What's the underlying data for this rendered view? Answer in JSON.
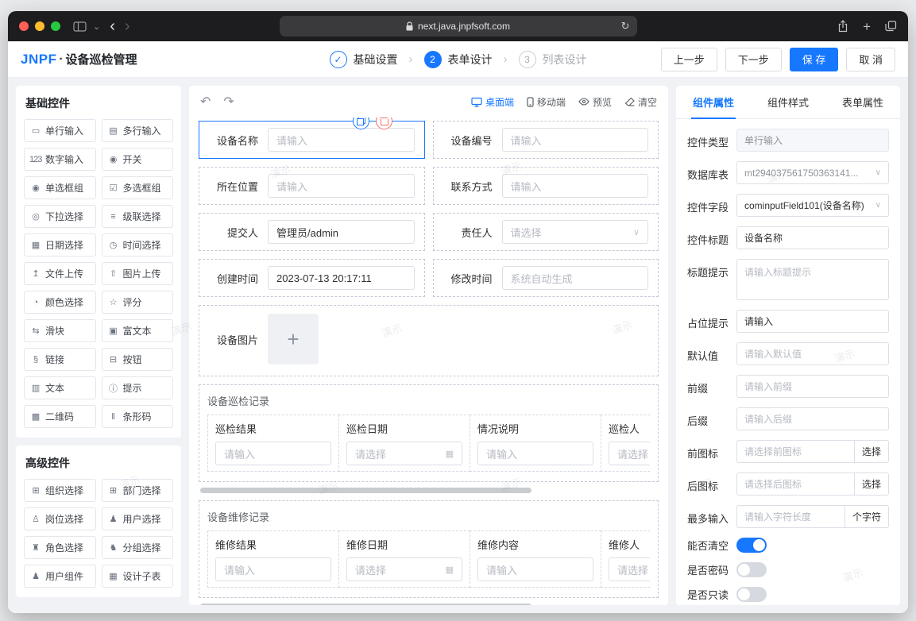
{
  "watermark": "演示",
  "colors": {
    "accent": "#1677ff",
    "danger": "#f56c6c",
    "traffic_red": "#ff5f57",
    "traffic_yellow": "#febc2e",
    "traffic_green": "#28c840"
  },
  "browser": {
    "url": "next.java.jnpfsoft.com"
  },
  "header": {
    "logo": "JNPF",
    "separator": "·",
    "title": "设备巡检管理",
    "steps": [
      {
        "num": "✓",
        "label": "基础设置"
      },
      {
        "num": "2",
        "label": "表单设计"
      },
      {
        "num": "3",
        "label": "列表设计"
      }
    ],
    "actions": [
      "上一步",
      "下一步",
      "保 存",
      "取 消"
    ]
  },
  "sidebar": {
    "groups": [
      {
        "title": "基础控件",
        "name": "basic-controls",
        "items": [
          {
            "icon": "▭",
            "label": "单行输入",
            "name": "single-line-input"
          },
          {
            "icon": "▤",
            "label": "多行输入",
            "name": "multi-line-input"
          },
          {
            "icon": "123",
            "label": "数字输入",
            "name": "number-input"
          },
          {
            "icon": "◉",
            "label": "开关",
            "name": "switch"
          },
          {
            "icon": "◉",
            "label": "单选框组",
            "name": "radio-group"
          },
          {
            "icon": "☑",
            "label": "多选框组",
            "name": "checkbox-group"
          },
          {
            "icon": "◎",
            "label": "下拉选择",
            "name": "select"
          },
          {
            "icon": "≡",
            "label": "级联选择",
            "name": "cascader"
          },
          {
            "icon": "▦",
            "label": "日期选择",
            "name": "date-picker"
          },
          {
            "icon": "◷",
            "label": "时间选择",
            "name": "time-picker"
          },
          {
            "icon": "↥",
            "label": "文件上传",
            "name": "file-upload"
          },
          {
            "icon": "⇧",
            "label": "图片上传",
            "name": "image-upload"
          },
          {
            "icon": "◔",
            "label": "颜色选择",
            "name": "color-picker"
          },
          {
            "icon": "☆",
            "label": "评分",
            "name": "rate"
          },
          {
            "icon": "⇆",
            "label": "滑块",
            "name": "slider"
          },
          {
            "icon": "▣",
            "label": "富文本",
            "name": "rich-text"
          },
          {
            "icon": "§",
            "label": "链接",
            "name": "link"
          },
          {
            "icon": "⊟",
            "label": "按钮",
            "name": "button"
          },
          {
            "icon": "▥",
            "label": "文本",
            "name": "text"
          },
          {
            "icon": "ⓘ",
            "label": "提示",
            "name": "alert"
          },
          {
            "icon": "▩",
            "label": "二维码",
            "name": "qr-code"
          },
          {
            "icon": "‖",
            "label": "条形码",
            "name": "barcode"
          }
        ]
      },
      {
        "title": "高级控件",
        "name": "advanced-controls",
        "items": [
          {
            "icon": "⊞",
            "label": "组织选择",
            "name": "org-select"
          },
          {
            "icon": "⊞",
            "label": "部门选择",
            "name": "dept-select"
          },
          {
            "icon": "♙",
            "label": "岗位选择",
            "name": "post-select"
          },
          {
            "icon": "♟",
            "label": "用户选择",
            "name": "user-select"
          },
          {
            "icon": "♜",
            "label": "角色选择",
            "name": "role-select"
          },
          {
            "icon": "♞",
            "label": "分组选择",
            "name": "group-select"
          },
          {
            "icon": "♟",
            "label": "用户组件",
            "name": "user-component"
          },
          {
            "icon": "▦",
            "label": "设计子表",
            "name": "design-subtable"
          }
        ]
      }
    ]
  },
  "canvas": {
    "toolbar": {
      "modes": [
        {
          "label": "桌面端",
          "active": true
        },
        {
          "label": "移动端",
          "active": false
        }
      ],
      "preview": "预览",
      "clear": "清空"
    },
    "fields": [
      {
        "label": "设备名称",
        "placeholder": "请输入",
        "type": "input",
        "selected": true,
        "name": "device-name"
      },
      {
        "label": "设备编号",
        "placeholder": "请输入",
        "type": "input",
        "name": "device-code"
      },
      {
        "label": "所在位置",
        "placeholder": "请输入",
        "type": "input",
        "name": "location"
      },
      {
        "label": "联系方式",
        "placeholder": "请输入",
        "type": "input",
        "name": "contact"
      },
      {
        "label": "提交人",
        "value": "管理员/admin",
        "type": "input",
        "name": "submitter"
      },
      {
        "label": "责任人",
        "placeholder": "请选择",
        "type": "select",
        "name": "owner"
      },
      {
        "label": "创建时间",
        "value": "2023-07-13 20:17:11",
        "type": "input",
        "name": "create-time"
      },
      {
        "label": "修改时间",
        "placeholder": "系统自动生成",
        "type": "input",
        "name": "modify-time"
      },
      {
        "label": "设备图片",
        "type": "upload",
        "name": "device-image"
      }
    ],
    "subtables": [
      {
        "title": "设备巡检记录",
        "name": "inspection-record",
        "columns": [
          {
            "label": "巡检结果",
            "placeholder": "请输入",
            "type": "input"
          },
          {
            "label": "巡检日期",
            "placeholder": "请选择",
            "type": "date"
          },
          {
            "label": "情况说明",
            "placeholder": "请输入",
            "type": "input"
          },
          {
            "label": "巡检人",
            "placeholder": "请选择",
            "type": "select"
          }
        ]
      },
      {
        "title": "设备维修记录",
        "name": "repair-record",
        "columns": [
          {
            "label": "维修结果",
            "placeholder": "请输入",
            "type": "input"
          },
          {
            "label": "维修日期",
            "placeholder": "请选择",
            "type": "date"
          },
          {
            "label": "维修内容",
            "placeholder": "请输入",
            "type": "input"
          },
          {
            "label": "维修人",
            "placeholder": "请选择",
            "type": "select"
          }
        ]
      }
    ]
  },
  "props": {
    "tabs": [
      "组件属性",
      "组件样式",
      "表单属性"
    ],
    "rows": [
      {
        "label": "控件类型",
        "type": "input-disabled",
        "value": "单行输入",
        "name": "control-type"
      },
      {
        "label": "数据库表",
        "type": "select",
        "value": "mt294037561750363141...",
        "muted": true,
        "name": "database-table"
      },
      {
        "label": "控件字段",
        "type": "select",
        "value": "cominputField101(设备名称)",
        "name": "control-field"
      },
      {
        "label": "控件标题",
        "type": "input",
        "value": "设备名称",
        "name": "control-label"
      },
      {
        "label": "标题提示",
        "type": "textarea",
        "placeholder": "请输入标题提示",
        "name": "label-tooltip"
      },
      {
        "label": "占位提示",
        "type": "input",
        "value": "请输入",
        "name": "placeholder"
      },
      {
        "label": "默认值",
        "type": "input",
        "placeholder": "请输入默认值",
        "name": "default-value"
      },
      {
        "label": "前缀",
        "type": "input",
        "placeholder": "请输入前缀",
        "name": "prefix"
      },
      {
        "label": "后缀",
        "type": "input",
        "placeholder": "请输入后缀",
        "name": "suffix"
      },
      {
        "label": "前图标",
        "type": "input-button",
        "placeholder": "请选择前图标",
        "button": "选择",
        "name": "prefix-icon"
      },
      {
        "label": "后图标",
        "type": "input-button",
        "placeholder": "请选择后图标",
        "button": "选择",
        "name": "suffix-icon"
      },
      {
        "label": "最多输入",
        "type": "input-suffix",
        "placeholder": "请输入字符长度",
        "suffix": "个字符",
        "name": "max-length"
      },
      {
        "label": "能否清空",
        "type": "switch",
        "value": true,
        "name": "clearable"
      },
      {
        "label": "是否密码",
        "type": "switch",
        "value": false,
        "name": "is-password"
      },
      {
        "label": "是否只读",
        "type": "switch",
        "value": false,
        "name": "is-readonly"
      }
    ]
  }
}
